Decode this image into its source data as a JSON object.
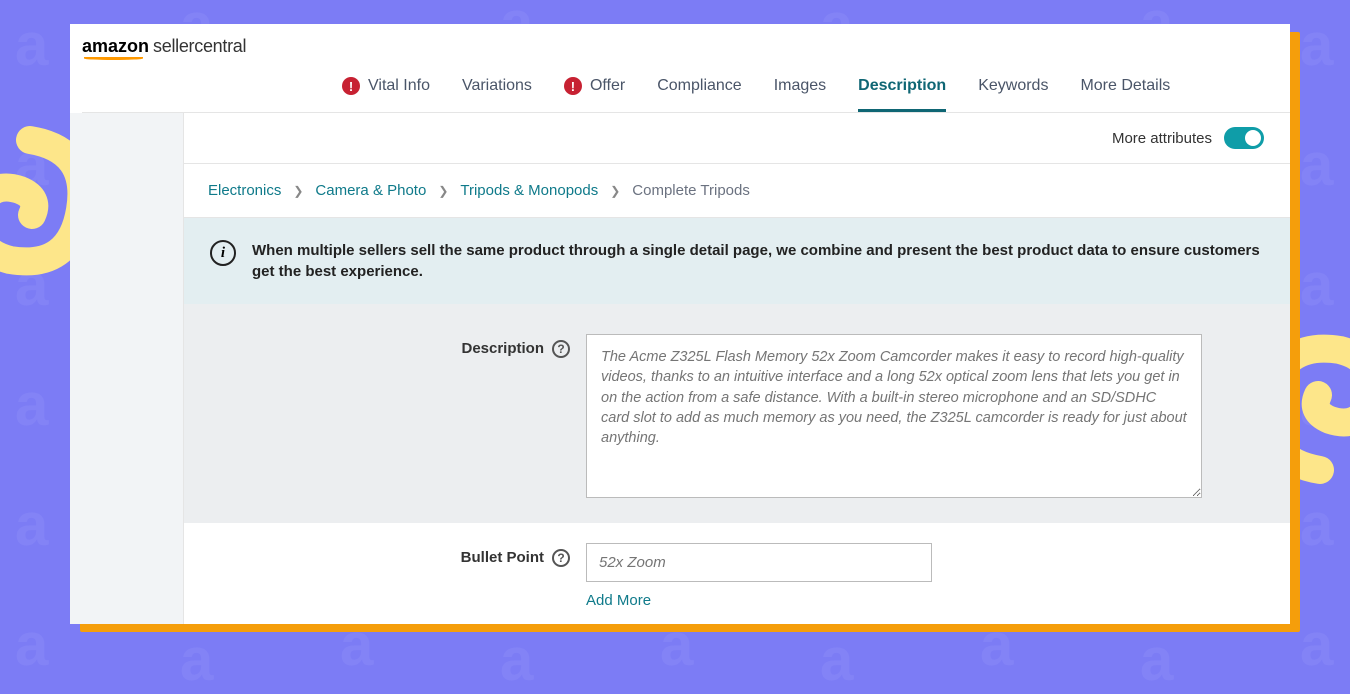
{
  "logo": {
    "amazon": "amazon",
    "sellercentral": "sellercentral"
  },
  "tabs": [
    {
      "label": "Vital Info",
      "alert": true
    },
    {
      "label": "Variations",
      "alert": false
    },
    {
      "label": "Offer",
      "alert": true
    },
    {
      "label": "Compliance",
      "alert": false
    },
    {
      "label": "Images",
      "alert": false
    },
    {
      "label": "Description",
      "alert": false,
      "active": true
    },
    {
      "label": "Keywords",
      "alert": false
    },
    {
      "label": "More Details",
      "alert": false
    }
  ],
  "more_attributes": {
    "label": "More attributes"
  },
  "breadcrumb": {
    "items": [
      "Electronics",
      "Camera & Photo",
      "Tripods & Monopods"
    ],
    "current": "Complete Tripods"
  },
  "info_banner": {
    "text": "When multiple sellers sell the same product through a single detail page, we combine and present the best product data to ensure customers get the best experience."
  },
  "form": {
    "description": {
      "label": "Description",
      "placeholder": "The Acme Z325L Flash Memory 52x Zoom Camcorder makes it easy to record high-quality videos, thanks to an intuitive interface and a long 52x optical zoom lens that lets you get in on the action from a safe distance. With a built-in stereo microphone and an SD/SDHC card slot to add as much memory as you need, the Z325L camcorder is ready for just about anything."
    },
    "bullet": {
      "label": "Bullet Point",
      "placeholder": "52x Zoom",
      "add_more": "Add More"
    }
  }
}
